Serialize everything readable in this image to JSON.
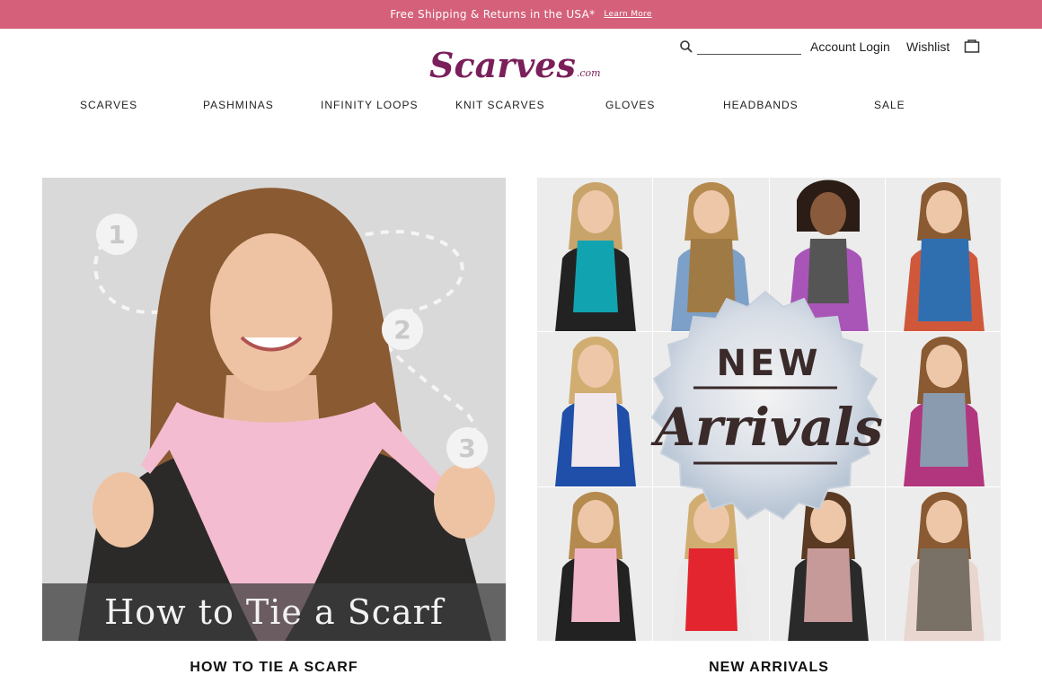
{
  "promo": {
    "text": "Free Shipping & Returns in the USA*",
    "link": "Learn More"
  },
  "brand": {
    "logo_main": "Scarves",
    "logo_suffix": ".com",
    "color": "#7a1f5a"
  },
  "header": {
    "search_placeholder": "",
    "account_login": "Account Login",
    "wishlist": "Wishlist",
    "cart_icon": "cart-icon"
  },
  "nav": {
    "items": [
      "SCARVES",
      "PASHMINAS",
      "INFINITY LOOPS",
      "KNIT SCARVES",
      "GLOVES",
      "HEADBANDS",
      "SALE"
    ]
  },
  "cards": [
    {
      "caption": "HOW TO TIE A SCARF",
      "overlay": "How to Tie a Scarf",
      "steps": [
        "1",
        "2",
        "3"
      ]
    },
    {
      "caption": "NEW ARRIVALS",
      "badge_line1": "NEW",
      "badge_line2": "Arrivals"
    }
  ],
  "colors": {
    "promo_bg": "#d4607a",
    "accent": "#7a1f5a"
  }
}
